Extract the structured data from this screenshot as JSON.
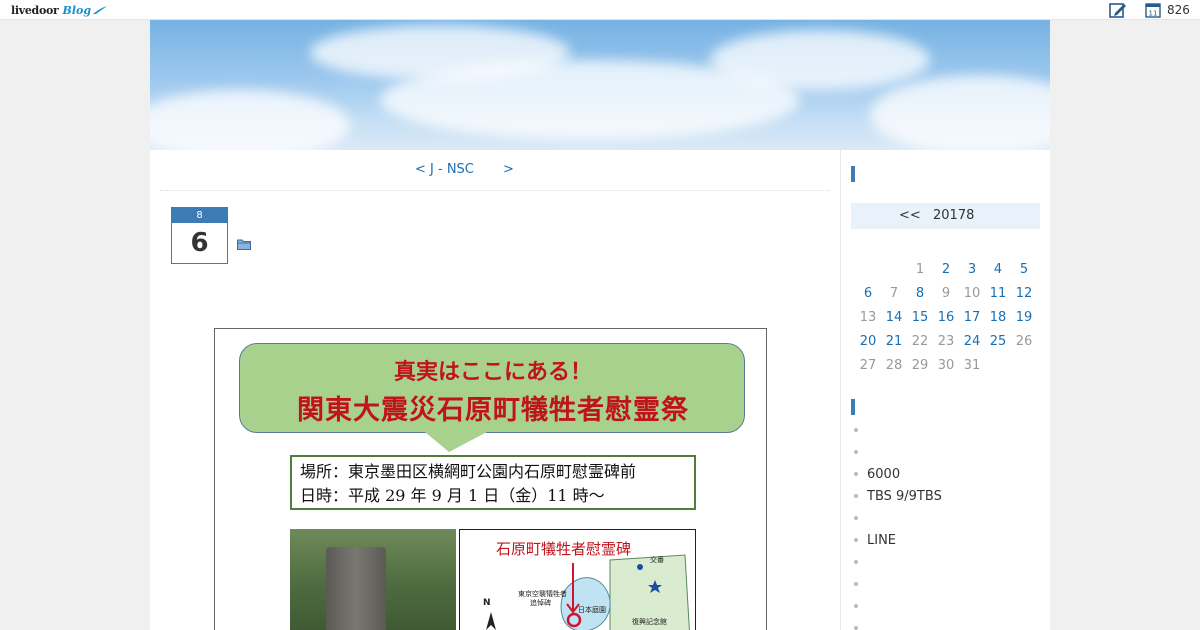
{
  "topbar": {
    "logo_main": "livedoor",
    "logo_blog": "Blog",
    "count": "826",
    "calendar_day": "11"
  },
  "nav": {
    "prev_label": "< J - NSC",
    "next_label": ">"
  },
  "post": {
    "month": "8",
    "day": "6"
  },
  "poster": {
    "headline1": "真実はここにある！",
    "headline2": "関東大震災石原町犠牲者慰霊祭",
    "place_line": "場所：東京墨田区横網町公園内石原町慰霊碑前",
    "date_line": "日時：平成 29 年 9 月 1 日（金）11 時～",
    "map_title": "石原町犠牲者慰霊碑",
    "map_labels": [
      "交番",
      "東京空襲犠牲者",
      "追悼碑",
      "日本庭園",
      "復興記念館",
      "N"
    ]
  },
  "calendar": {
    "prev": "<<",
    "month_label": "20178",
    "weeks": [
      [
        {
          "d": "",
          "link": false
        },
        {
          "d": "",
          "link": false
        },
        {
          "d": "1",
          "link": false
        },
        {
          "d": "2",
          "link": true
        },
        {
          "d": "3",
          "link": true
        },
        {
          "d": "4",
          "link": true
        },
        {
          "d": "5",
          "link": true
        }
      ],
      [
        {
          "d": "6",
          "link": true
        },
        {
          "d": "7",
          "link": false
        },
        {
          "d": "8",
          "link": true
        },
        {
          "d": "9",
          "link": false
        },
        {
          "d": "10",
          "link": false
        },
        {
          "d": "11",
          "link": true
        },
        {
          "d": "12",
          "link": true
        }
      ],
      [
        {
          "d": "13",
          "link": false
        },
        {
          "d": "14",
          "link": true
        },
        {
          "d": "15",
          "link": true
        },
        {
          "d": "16",
          "link": true
        },
        {
          "d": "17",
          "link": true
        },
        {
          "d": "18",
          "link": true
        },
        {
          "d": "19",
          "link": true
        }
      ],
      [
        {
          "d": "20",
          "link": true
        },
        {
          "d": "21",
          "link": true
        },
        {
          "d": "22",
          "link": false
        },
        {
          "d": "23",
          "link": false
        },
        {
          "d": "24",
          "link": true
        },
        {
          "d": "25",
          "link": true
        },
        {
          "d": "26",
          "link": false
        }
      ],
      [
        {
          "d": "27",
          "link": false
        },
        {
          "d": "28",
          "link": false
        },
        {
          "d": "29",
          "link": false
        },
        {
          "d": "30",
          "link": false
        },
        {
          "d": "31",
          "link": false
        },
        {
          "d": "",
          "link": false
        },
        {
          "d": "",
          "link": false
        }
      ]
    ]
  },
  "recent": [
    "",
    "",
    "6000",
    "TBS 9/9TBS",
    "",
    "LINE",
    "",
    "",
    "",
    ""
  ],
  "colors": {
    "accent": "#3d7bb5",
    "link": "#1a6fb4",
    "poster_red": "#c0141b",
    "bubble_green": "#a9d18e"
  }
}
